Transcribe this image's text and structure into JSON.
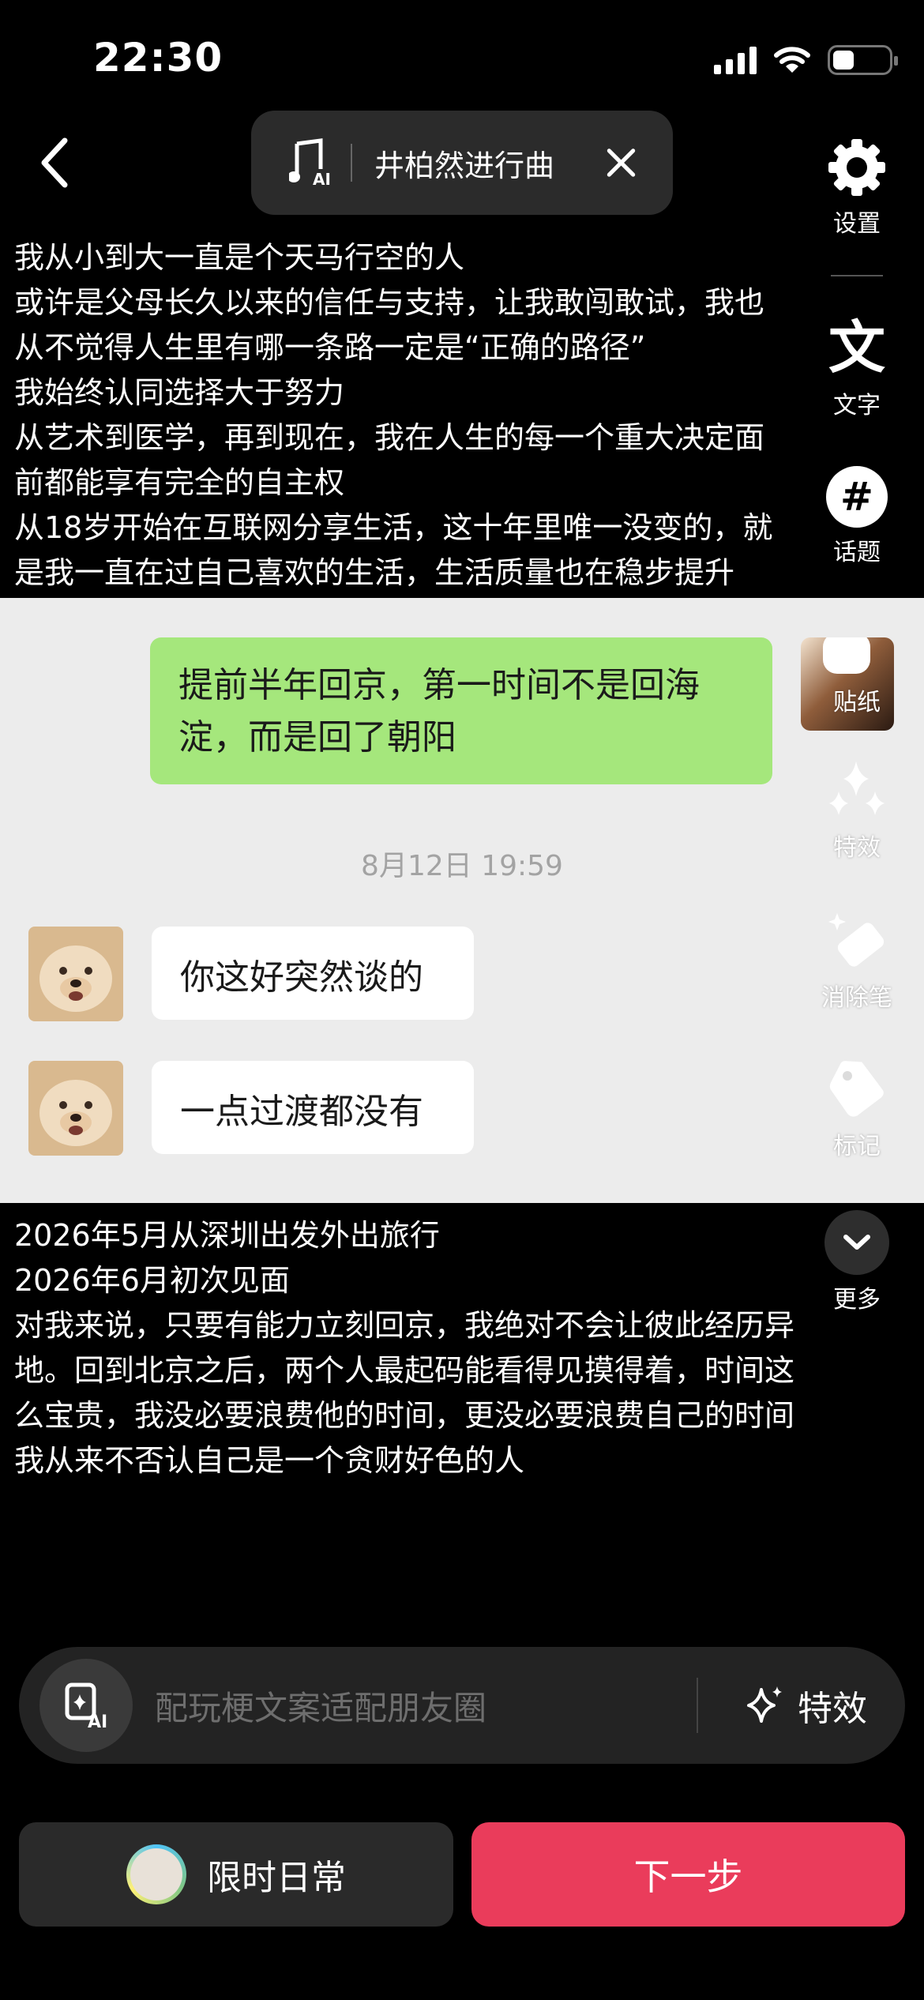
{
  "status_bar": {
    "time": "22:30"
  },
  "top_bar": {
    "music_title": "井柏然进行曲",
    "music_ai_badge": "AI"
  },
  "tools": {
    "settings": "设置",
    "text": "文字",
    "text_glyph": "文",
    "topic": "话题",
    "topic_glyph": "#",
    "sticker": "贴纸",
    "effects": "特效",
    "eraser": "消除笔",
    "mark": "标记",
    "more": "更多"
  },
  "overlay_top": [
    "我从小到大一直是个天马行空的人",
    "或许是父母长久以来的信任与支持，让我敢闯敢试，我也",
    "从不觉得人生里有哪一条路一定是“正确的路径”",
    "我始终认同选择大于努力",
    "从艺术到医学，再到现在，我在人生的每一个重大决定面",
    "前都能享有完全的自主权",
    "从18岁开始在互联网分享生活，这十年里唯一没变的，就",
    "是我一直在过自己喜欢的生活，生活质量也在稳步提升"
  ],
  "chat": {
    "sent_message_lines": [
      "提前半年回京，第一时间不是回海",
      "淀，而是回了朝阳"
    ],
    "timestamp": "8月12日 19:59",
    "received": [
      "你这好突然谈的",
      "一点过渡都没有"
    ]
  },
  "overlay_bottom": [
    "2026年5月从深圳出发外出旅行",
    "2026年6月初次见面",
    "对我来说，只要有能力立刻回京，我绝对不会让彼此经历异",
    "地。回到北京之后，两个人最起码能看得见摸得着，时间这",
    "么宝贵，我没必要浪费他的时间，更没必要浪费自己的时间",
    "我从来不否认自己是一个贪财好色的人"
  ],
  "input_bar": {
    "placeholder": "配玩梗文案适配朋友圈",
    "effects_label": "特效",
    "ai_badge": "AI"
  },
  "bottom": {
    "daily_label": "限时日常",
    "next_label": "下一步"
  },
  "colors": {
    "accent_red": "#ea3c5b",
    "chat_green": "#a5e77c",
    "chat_bg": "#ececec"
  }
}
